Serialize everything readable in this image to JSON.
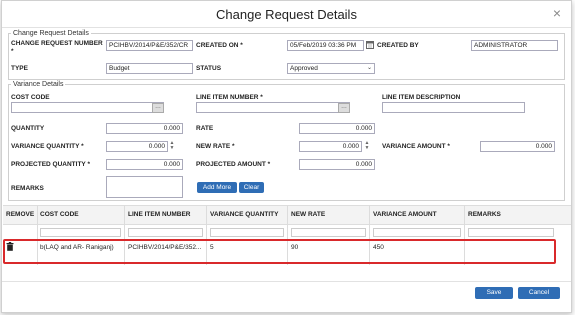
{
  "dialog": {
    "title": "Change Request Details",
    "close_glyph": "×"
  },
  "header_section": {
    "legend": "Change Request Details",
    "cr_number_label": "CHANGE REQUEST NUMBER *",
    "cr_number_value": "PCIHBV/2014/P&E/352/CR",
    "created_on_label": "CREATED ON *",
    "created_on_value": "05/Feb/2019 03:36 PM",
    "created_by_label": "CREATED BY",
    "created_by_value": "ADMINISTRATOR",
    "type_label": "TYPE",
    "type_value": "Budget",
    "status_label": "STATUS",
    "status_value": "Approved"
  },
  "variance_section": {
    "legend": "Variance Details",
    "cost_code_label": "COST CODE",
    "line_item_number_label": "LINE ITEM NUMBER *",
    "line_item_desc_label": "LINE ITEM DESCRIPTION",
    "quantity_label": "QUANTITY",
    "quantity_value": "0.000",
    "rate_label": "RATE",
    "rate_value": "0.000",
    "variance_qty_label": "VARIANCE QUANTITY *",
    "variance_qty_value": "0.000",
    "new_rate_label": "NEW RATE *",
    "new_rate_value": "0.000",
    "variance_amount_label": "VARIANCE AMOUNT *",
    "variance_amount_value": "0.000",
    "projected_qty_label": "PROJECTED QUANTITY *",
    "projected_qty_value": "0.000",
    "projected_amount_label": "PROJECTED AMOUNT *",
    "projected_amount_value": "0.000",
    "remarks_label": "REMARKS",
    "add_more_label": "Add More",
    "clear_label": "Clear"
  },
  "grid": {
    "columns": [
      "REMOVE",
      "COST CODE",
      "LINE ITEM NUMBER",
      "VARIANCE QUANTITY",
      "NEW RATE",
      "VARIANCE AMOUNT",
      "REMARKS"
    ],
    "rows": [
      {
        "cost_code": "b(LAQ and AR- Raniganj)",
        "line_item_number": "PCIHBV/2014/P&E/352...",
        "variance_quantity": "5",
        "new_rate": "90",
        "variance_amount": "450",
        "remarks": ""
      }
    ]
  },
  "footer": {
    "save_label": "Save",
    "cancel_label": "Cancel"
  },
  "colors": {
    "primary_button": "#2f6db5",
    "highlight_border": "#d9292b"
  },
  "icons": {
    "calendar": "calendar-icon",
    "lookup": "ellipsis-icon",
    "dropdown": "chevron-down-icon",
    "trash": "trash-icon",
    "close": "close-icon"
  }
}
